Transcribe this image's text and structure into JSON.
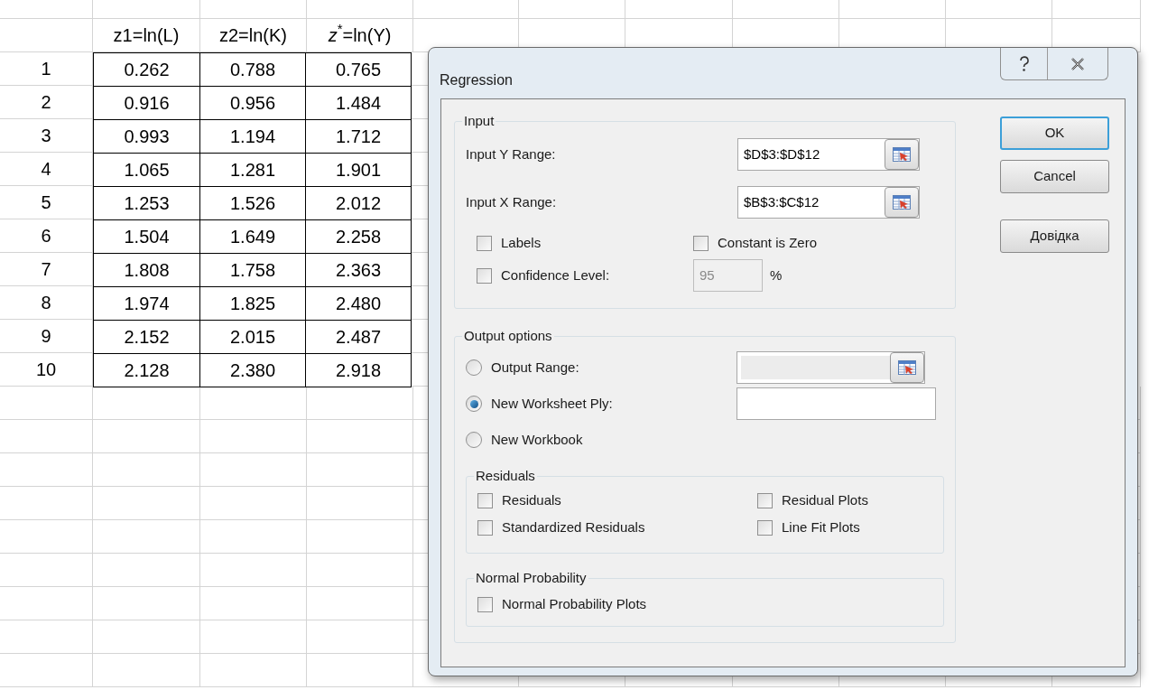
{
  "sheet": {
    "columns": [
      "z1=ln(L)",
      "z2=ln(K)",
      "*z*$^{*}$=ln(Y)"
    ],
    "rows": [
      {
        "label": "1",
        "values": [
          "0.262",
          "0.788",
          "0.765"
        ]
      },
      {
        "label": "2",
        "values": [
          "0.916",
          "0.956",
          "1.484"
        ]
      },
      {
        "label": "3",
        "values": [
          "0.993",
          "1.194",
          "1.712"
        ]
      },
      {
        "label": "4",
        "values": [
          "1.065",
          "1.281",
          "1.901"
        ]
      },
      {
        "label": "5",
        "values": [
          "1.253",
          "1.526",
          "2.012"
        ]
      },
      {
        "label": "6",
        "values": [
          "1.504",
          "1.649",
          "2.258"
        ]
      },
      {
        "label": "7",
        "values": [
          "1.808",
          "1.758",
          "2.363"
        ]
      },
      {
        "label": "8",
        "values": [
          "1.974",
          "1.825",
          "2.480"
        ]
      },
      {
        "label": "9",
        "values": [
          "2.152",
          "2.015",
          "2.487"
        ]
      },
      {
        "label": "10",
        "values": [
          "2.128",
          "2.380",
          "2.918"
        ]
      }
    ]
  },
  "dialog": {
    "title": "Regression",
    "input": {
      "legend": "Input",
      "ranges": [
        {
          "label": "Input Y Range:",
          "value": "$D$3:$D$12"
        },
        {
          "label": "Input X Range:",
          "value": "$B$3:$C$12"
        }
      ],
      "labels": {
        "label": "Labels",
        "checked": false
      },
      "constant_zero": {
        "label": "Constant is Zero",
        "checked": false
      },
      "confidence": {
        "label": "Confidence Level:",
        "checked": false,
        "value": "95",
        "disabled": true,
        "unit": "%"
      }
    },
    "output": {
      "legend": "Output options",
      "options": [
        {
          "label": "Output Range:",
          "selected": false,
          "kind": "range"
        },
        {
          "label": "New Worksheet Ply:",
          "selected": true,
          "kind": "text"
        },
        {
          "label": "New Workbook",
          "selected": false,
          "kind": "plain"
        }
      ],
      "residuals": {
        "legend": "Residuals",
        "checks": [
          {
            "label": "Residuals",
            "checked": false
          },
          {
            "label": "Residual Plots",
            "checked": false
          },
          {
            "label": "Standardized Residuals",
            "checked": false
          },
          {
            "label": "Line Fit Plots",
            "checked": false
          }
        ]
      },
      "normal": {
        "legend": "Normal Probability",
        "checks": [
          {
            "label": "Normal Probability Plots",
            "checked": false
          }
        ]
      }
    },
    "buttons": [
      {
        "label": "OK",
        "default": true
      },
      {
        "label": "Cancel",
        "default": false
      },
      {
        "label": "Довідка",
        "default": false
      }
    ]
  }
}
